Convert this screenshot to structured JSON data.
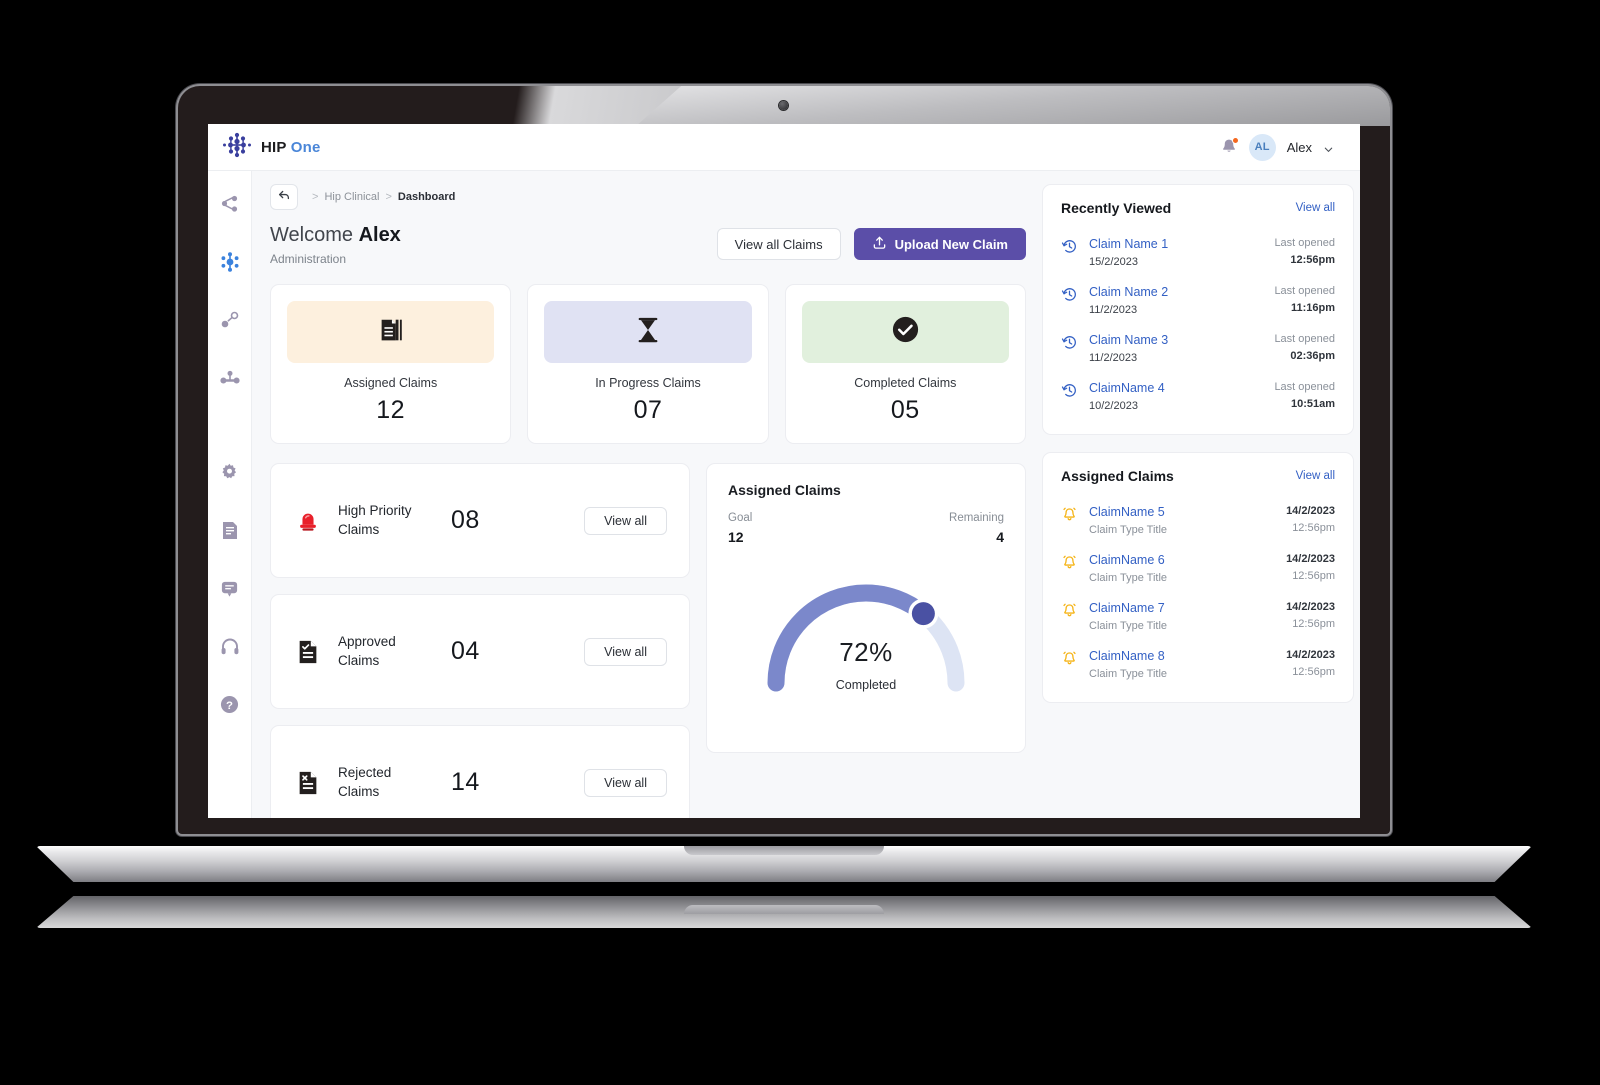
{
  "brand": {
    "name_bold": "HIP",
    "name_light": "One",
    "logo_icon": "molecule-network-icon"
  },
  "topbar": {
    "notification_icon": "bell-icon",
    "avatar_initials": "AL",
    "user_name": "Alex",
    "chevron_icon": "chevron-down-icon"
  },
  "rail": {
    "items": [
      {
        "icon": "share-nodes-icon",
        "active": false
      },
      {
        "icon": "molecule-nodes-icon",
        "active": true
      },
      {
        "icon": "node-link-icon",
        "active": false
      },
      {
        "icon": "nodes-group-icon",
        "active": false
      },
      {
        "icon": "gear-icon",
        "active": false
      },
      {
        "icon": "document-list-icon",
        "active": false
      },
      {
        "icon": "chat-bubble-icon",
        "active": false
      },
      {
        "icon": "headset-icon",
        "active": false
      },
      {
        "icon": "help-circle-icon",
        "active": false
      }
    ]
  },
  "breadcrumb": {
    "back_icon": "back-arrow-icon",
    "lead_sep": ">",
    "parent": "Hip Clinical",
    "sep": ">",
    "current": "Dashboard"
  },
  "welcome": {
    "greeting": "Welcome",
    "user": "Alex",
    "subtitle": "Administration"
  },
  "actions": {
    "view_all_claims": "View all Claims",
    "upload_new_claim": "Upload New Claim",
    "upload_icon": "upload-icon"
  },
  "stat_cards": [
    {
      "label": "Assigned Claims",
      "value": "12",
      "icon": "documents-stack-icon",
      "bg": "#fdf0de"
    },
    {
      "label": "In Progress Claims",
      "value": "07",
      "icon": "hourglass-icon",
      "bg": "#e0e2f3"
    },
    {
      "label": "Completed Claims",
      "value": "05",
      "icon": "check-circle-icon",
      "bg": "#e1f0dd"
    }
  ],
  "mini_cards": [
    {
      "label": "High Priority Claims",
      "value": "08",
      "icon": "siren-alarm-icon",
      "button": "View all"
    },
    {
      "label": "Approved Claims",
      "value": "04",
      "icon": "document-check-icon",
      "button": "View all"
    },
    {
      "label": "Rejected Claims",
      "value": "14",
      "icon": "document-x-icon",
      "button": "View all"
    }
  ],
  "gauge": {
    "title": "Assigned Claims",
    "goal_label": "Goal",
    "goal_value": "12",
    "remaining_label": "Remaining",
    "remaining_value": "4",
    "percent_text": "72%",
    "caption": "Completed"
  },
  "chart_data": {
    "type": "pie",
    "title": "Assigned Claims",
    "subtype": "semicircle-gauge",
    "percent": 72,
    "goal": 12,
    "remaining": 4,
    "completed": 8,
    "value_label": "72%",
    "caption": "Completed",
    "colors": {
      "filled": "#7b88cb",
      "track": "#dde4f4",
      "knob": "#4a51a3"
    },
    "range": [
      0,
      100
    ],
    "legend": []
  },
  "recently_viewed": {
    "title": "Recently Viewed",
    "link": "View all",
    "items": [
      {
        "icon": "history-clock-icon",
        "name": "Claim Name 1",
        "date": "15/2/2023",
        "status": "Last opened",
        "time": "12:56pm"
      },
      {
        "icon": "history-clock-icon",
        "name": "Claim Name 2",
        "date": "11/2/2023",
        "status": "Last opened",
        "time": "11:16pm"
      },
      {
        "icon": "history-clock-icon",
        "name": "Claim Name 3",
        "date": "11/2/2023",
        "status": "Last opened",
        "time": "02:36pm"
      },
      {
        "icon": "history-clock-icon",
        "name": "ClaimName 4",
        "date": "10/2/2023",
        "status": "Last opened",
        "time": "10:51am"
      }
    ]
  },
  "assigned_claims": {
    "title": "Assigned Claims",
    "link": "View all",
    "items": [
      {
        "icon": "bell-ring-icon",
        "name": "ClaimName 5",
        "type": "Claim Type Title",
        "date": "14/2/2023",
        "time": "12:56pm"
      },
      {
        "icon": "bell-ring-icon",
        "name": "ClaimName 6",
        "type": "Claim Type Title",
        "date": "14/2/2023",
        "time": "12:56pm"
      },
      {
        "icon": "bell-ring-icon",
        "name": "ClaimName 7",
        "type": "Claim Type Title",
        "date": "14/2/2023",
        "time": "12:56pm"
      },
      {
        "icon": "bell-ring-icon",
        "name": "ClaimName 8",
        "type": "Claim Type Title",
        "date": "14/2/2023",
        "time": "12:56pm"
      }
    ]
  }
}
